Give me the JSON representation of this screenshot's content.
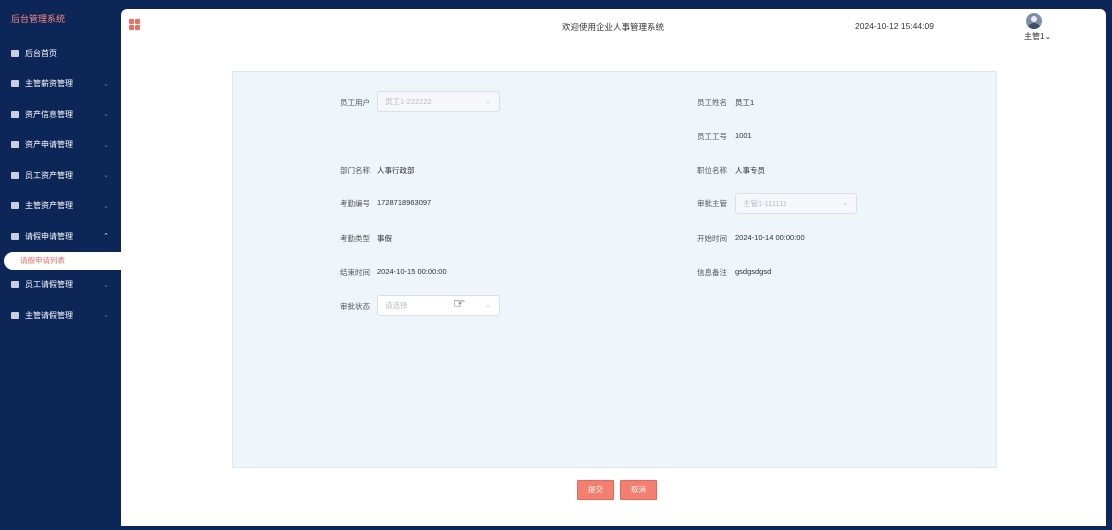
{
  "sidebar": {
    "brand": "后台管理系统",
    "items": [
      {
        "label": "后台首页"
      },
      {
        "label": "主管薪资管理"
      },
      {
        "label": "资产信息管理"
      },
      {
        "label": "资产申请管理"
      },
      {
        "label": "员工资产管理"
      },
      {
        "label": "主管资产管理"
      },
      {
        "label": "请假申请管理"
      },
      {
        "label": "员工请假管理"
      },
      {
        "label": "主管请假管理"
      }
    ],
    "active_sub": "请假申请列表"
  },
  "header": {
    "title": "欢迎使用企业人事管理系统",
    "time": "2024-10-12 15:44:09",
    "user": "主管1"
  },
  "form": {
    "employee_user": {
      "label": "员工用户",
      "value": "员工1-222222"
    },
    "employee_name": {
      "label": "员工姓名",
      "value": "员工1"
    },
    "employee_no": {
      "label": "员工工号",
      "value": "1001"
    },
    "dept_name": {
      "label": "部门名称",
      "value": "人事行政部"
    },
    "position_name": {
      "label": "职位名称",
      "value": "人事专员"
    },
    "attendance_no": {
      "label": "考勤编号",
      "value": "1728718963097"
    },
    "approver": {
      "label": "审批主管",
      "value": "主管1-111111"
    },
    "attendance_type": {
      "label": "考勤类型",
      "value": "事假"
    },
    "start_time": {
      "label": "开始时间",
      "value": "2024-10-14 00:00:00"
    },
    "end_time": {
      "label": "结束时间",
      "value": "2024-10-15 00:00:00"
    },
    "remark": {
      "label": "信息备注",
      "value": "gsdgsdgsd"
    },
    "approval_status": {
      "label": "审批状态",
      "placeholder": "请选择"
    }
  },
  "buttons": {
    "submit": "提交",
    "cancel": "取消"
  },
  "colors": {
    "sidebar_bg": "#0b2657",
    "accent": "#f57f6e",
    "form_bg": "#eef5fb"
  }
}
